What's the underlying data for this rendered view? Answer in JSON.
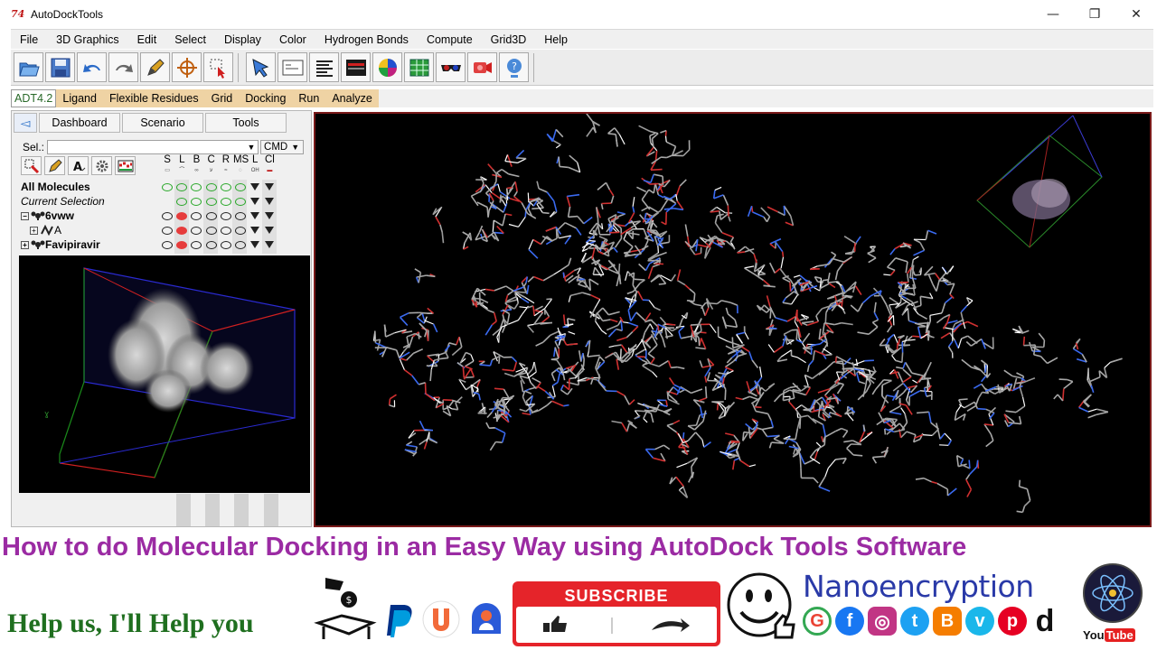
{
  "window": {
    "title": "AutoDockTools",
    "icon_text": "74",
    "controls": [
      "—",
      "❐",
      "✕"
    ]
  },
  "menu": [
    "File",
    "3D Graphics",
    "Edit",
    "Select",
    "Display",
    "Color",
    "Hydrogen Bonds",
    "Compute",
    "Grid3D",
    "Help"
  ],
  "toolbar": {
    "buttons": [
      "open-icon",
      "save-icon",
      "undo-icon",
      "redo-icon",
      "pencil-icon",
      "crosshair-icon",
      "select-icon",
      "pointer-icon",
      "console-icon",
      "text-icon",
      "display-icon",
      "color-icon",
      "grid-icon",
      "stereo-icon",
      "camera-icon",
      "help-icon"
    ]
  },
  "adt_tabs": [
    "ADT4.2",
    "Ligand",
    "Flexible Residues",
    "Grid",
    "Docking",
    "Run",
    "Analyze"
  ],
  "dashboard": {
    "tabs": [
      "Dashboard",
      "Scenario",
      "Tools"
    ],
    "sel_label": "Sel.:",
    "cmd_label": "CMD",
    "columns": [
      {
        "label": "S",
        "sub": ""
      },
      {
        "label": "L",
        "sub": ""
      },
      {
        "label": "B",
        "sub": ""
      },
      {
        "label": "C",
        "sub": ""
      },
      {
        "label": "R",
        "sub": ""
      },
      {
        "label": "MS",
        "sub": ""
      },
      {
        "label": "L",
        "sub": "OH"
      },
      {
        "label": "Cl",
        "sub": ""
      }
    ],
    "tree": [
      {
        "label": "All Molecules",
        "style": "bold",
        "expander": ""
      },
      {
        "label": "Current Selection",
        "style": "italic",
        "expander": ""
      },
      {
        "label": "6vww",
        "style": "bold",
        "expander": "⊟"
      },
      {
        "label": "A",
        "style": "normal",
        "expander": "⊞"
      },
      {
        "label": "Favipiravir",
        "style": "bold",
        "expander": "⊞"
      }
    ]
  },
  "caption": "How to do Molecular Docking in an Easy Way using AutoDock Tools Software",
  "promo": {
    "help_text": "Help us, I'll Help you",
    "subscribe_label": "SUBSCRIBE",
    "brand": "Nanoencryption",
    "youtube_word_1": "You",
    "youtube_word_2": "Tube",
    "social_icons": [
      {
        "icon": "google-icon",
        "glyph": "G",
        "color": "#ea4335"
      },
      {
        "icon": "facebook-icon",
        "glyph": "f",
        "color": "#1877f2"
      },
      {
        "icon": "instagram-icon",
        "glyph": "◎",
        "color": "#c13584"
      },
      {
        "icon": "twitter-icon",
        "glyph": "t",
        "color": "#1da1f2"
      },
      {
        "icon": "blogger-icon",
        "glyph": "B",
        "color": "#f57d00"
      },
      {
        "icon": "vimeo-icon",
        "glyph": "v",
        "color": "#1ab7ea"
      },
      {
        "icon": "pinterest-icon",
        "glyph": "p",
        "color": "#e60023"
      },
      {
        "icon": "dailymotion-icon",
        "glyph": "d",
        "color": "#111111"
      }
    ],
    "colors": {
      "caption": "#9b2ba3",
      "help": "#1f6f1f",
      "subscribe": "#e5242a",
      "brand": "#2a3aa8"
    }
  }
}
